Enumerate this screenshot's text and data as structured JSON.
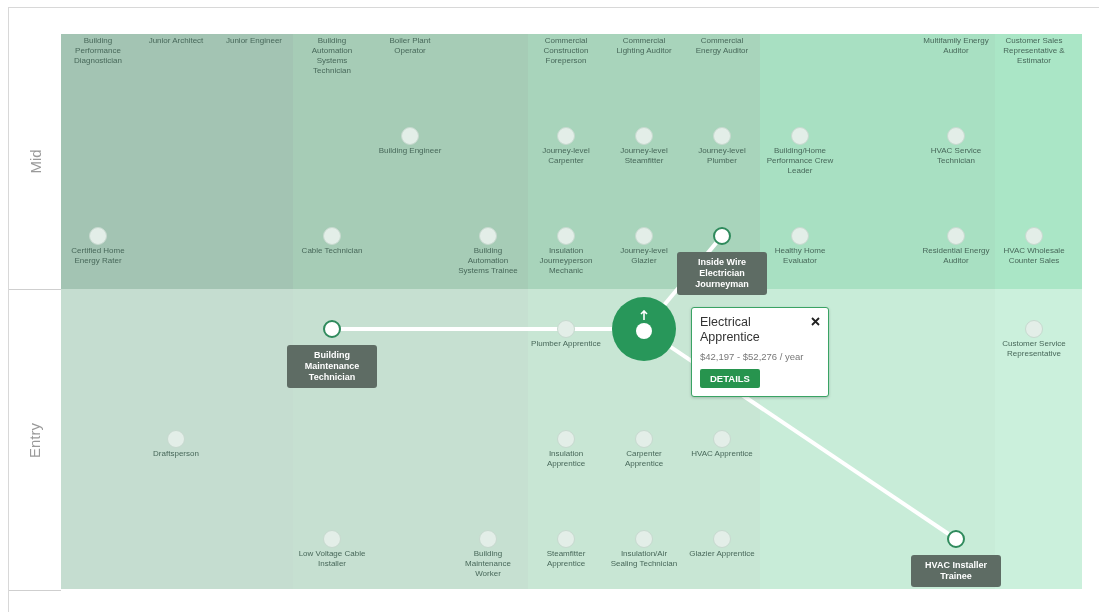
{
  "levels": [
    {
      "label": "Mid"
    },
    {
      "label": "Entry"
    }
  ],
  "rows": [
    {
      "cells": [
        {
          "label": "Building Performance Diagnostician",
          "selected": false,
          "kind": "plain"
        },
        {
          "label": "Junior Architect",
          "selected": false,
          "kind": "plain"
        },
        {
          "label": "Junior Engineer",
          "selected": false,
          "kind": "plain"
        },
        {
          "label": "Building Automation Systems Technician",
          "selected": false,
          "kind": "plain"
        },
        {
          "label": "Boiler Plant Operator",
          "selected": false,
          "kind": "plain"
        },
        null,
        {
          "label": "Commercial Construction Foreperson",
          "selected": false,
          "kind": "plain"
        },
        {
          "label": "Commercial Lighting Auditor",
          "selected": false,
          "kind": "plain"
        },
        {
          "label": "Commercial Energy Auditor",
          "selected": false,
          "kind": "plain"
        },
        null,
        null,
        {
          "label": "Multifamily Energy Auditor",
          "selected": false,
          "kind": "plain"
        },
        {
          "label": "Customer Sales Representative & Estimator",
          "selected": false,
          "kind": "plain"
        }
      ]
    },
    {
      "cells": [
        null,
        null,
        null,
        null,
        {
          "label": "Building Engineer",
          "selected": false,
          "kind": "plain"
        },
        null,
        {
          "label": "Journey-level Carpenter",
          "selected": false,
          "kind": "plain"
        },
        {
          "label": "Journey-level Steamfitter",
          "selected": false,
          "kind": "plain"
        },
        {
          "label": "Journey-level Plumber",
          "selected": false,
          "kind": "plain"
        },
        {
          "label": "Building/Home Performance Crew Leader",
          "selected": false,
          "kind": "plain"
        },
        null,
        {
          "label": "HVAC Service Technician",
          "selected": false,
          "kind": "plain"
        },
        null
      ]
    },
    {
      "cells": [
        {
          "label": "Certified Home Energy Rater",
          "selected": false,
          "kind": "plain"
        },
        null,
        null,
        {
          "label": "Cable Technician",
          "selected": false,
          "kind": "plain"
        },
        null,
        {
          "label": "Building Automation Systems Trainee",
          "selected": false,
          "kind": "plain"
        },
        {
          "label": "Insulation Journeyperson Mechanic",
          "selected": false,
          "kind": "plain"
        },
        {
          "label": "Journey-level Glazier",
          "selected": false,
          "kind": "plain"
        },
        {
          "label": "Inside Wire Electrician Journeyman",
          "selected": false,
          "kind": "path"
        },
        {
          "label": "Healthy Home Evaluator",
          "selected": false,
          "kind": "plain"
        },
        null,
        {
          "label": "Residential Energy Auditor",
          "selected": false,
          "kind": "plain"
        },
        {
          "label": "HVAC Wholesale Counter Sales",
          "selected": false,
          "kind": "plain"
        }
      ]
    },
    {
      "cells": [
        null,
        null,
        null,
        {
          "label": "Building Maintenance Technician",
          "selected": false,
          "kind": "path"
        },
        null,
        null,
        {
          "label": "Plumber Apprentice",
          "selected": false,
          "kind": "plain"
        },
        {
          "label": "Electrical Apprentice",
          "selected": true,
          "kind": "plain"
        },
        null,
        null,
        null,
        null,
        {
          "label": "Customer Service Representative",
          "selected": false,
          "kind": "plain"
        }
      ]
    },
    {
      "cells": [
        null,
        {
          "label": "Draftsperson",
          "selected": false,
          "kind": "plain"
        },
        null,
        null,
        null,
        null,
        {
          "label": "Insulation Apprentice",
          "selected": false,
          "kind": "plain"
        },
        {
          "label": "Carpenter Apprentice",
          "selected": false,
          "kind": "plain"
        },
        {
          "label": "HVAC Apprentice",
          "selected": false,
          "kind": "plain"
        },
        null,
        null,
        null,
        null
      ]
    },
    {
      "cells": [
        null,
        null,
        null,
        {
          "label": "Low Voltage Cable Installer",
          "selected": false,
          "kind": "plain"
        },
        null,
        {
          "label": "Building Maintenance Worker",
          "selected": false,
          "kind": "plain"
        },
        {
          "label": "Steamfitter Apprentice",
          "selected": false,
          "kind": "plain"
        },
        {
          "label": "Insulation/Air Sealing Technician",
          "selected": false,
          "kind": "plain"
        },
        {
          "label": "Glazier Apprentice",
          "selected": false,
          "kind": "plain"
        },
        null,
        null,
        {
          "label": "HVAC Installer Trainee",
          "selected": false,
          "kind": "path"
        },
        null
      ]
    }
  ],
  "popup": {
    "salary": "$42,197 - $52,276 / year",
    "button": "DETAILS"
  }
}
